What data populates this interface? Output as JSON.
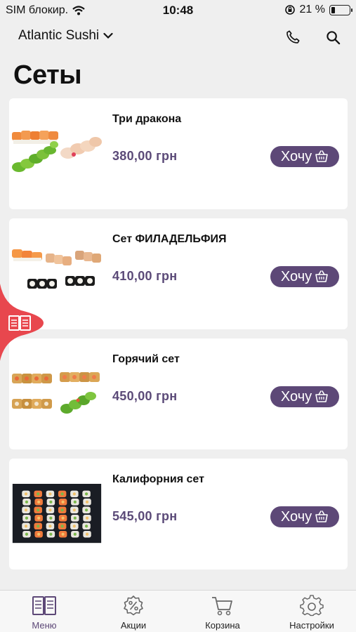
{
  "status_bar": {
    "carrier": "SIM блокир.",
    "time": "10:48",
    "battery": "21 %",
    "battery_level": 0.21
  },
  "header": {
    "store_name": "Atlantic Sushi",
    "icons": [
      "chevron-down-icon",
      "phone-icon",
      "search-icon"
    ]
  },
  "page": {
    "title": "Сеты"
  },
  "products": [
    {
      "name": "Три дракона",
      "price": "380,00 грн",
      "button": "Хочу"
    },
    {
      "name": "Сет ФИЛАДЕЛЬФИЯ",
      "price": "410,00 грн",
      "button": "Хочу"
    },
    {
      "name": "Горячий сет",
      "price": "450,00 грн",
      "button": "Хочу"
    },
    {
      "name": "Калифорния сет",
      "price": "545,00 грн",
      "button": "Хочу"
    }
  ],
  "side_tab": {
    "icon": "menu-book-icon",
    "color": "#e8474e"
  },
  "bottom_nav": {
    "items": [
      {
        "label": "Меню",
        "icon": "menu-book-icon",
        "active": true
      },
      {
        "label": "Акции",
        "icon": "discount-badge-icon",
        "active": false
      },
      {
        "label": "Корзина",
        "icon": "cart-icon",
        "active": false
      },
      {
        "label": "Настройки",
        "icon": "gear-icon",
        "active": false
      }
    ]
  },
  "colors": {
    "accent": "#5d4877",
    "price": "#5b4a78",
    "side_tab": "#e8474e",
    "background": "#efefef"
  }
}
